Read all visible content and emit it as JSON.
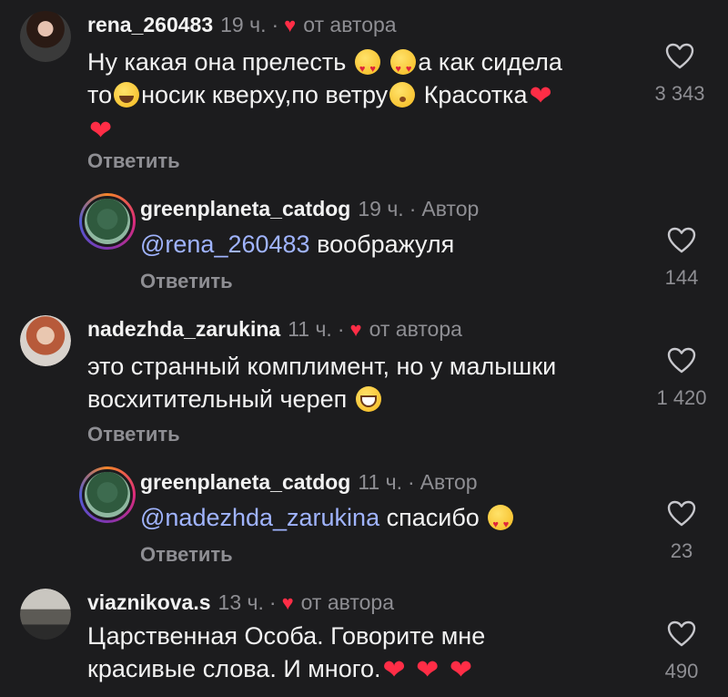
{
  "comments": [
    {
      "username": "rena_260483",
      "time": "19 ч.",
      "dot": "·",
      "from_author": "от автора",
      "text_parts": [
        "Ну какая она прелесть ",
        "а как сидела",
        "то",
        "носик кверху,по ветру",
        "Красотка"
      ],
      "reply_label": "Ответить",
      "likes": "3 343"
    },
    {
      "username": "greenplaneta_catdog",
      "time": "19 ч.",
      "dot": "·",
      "author_badge": "Автор",
      "mention": "@rena_260483",
      "text": " воображуля",
      "reply_label": "Ответить",
      "likes": "144"
    },
    {
      "username": "nadezhda_zarukina",
      "time": "11 ч.",
      "dot": "·",
      "from_author": "от автора",
      "text_line1": "это странный комплимент, но у малышки",
      "text_line2": "восхитительный череп",
      "reply_label": "Ответить",
      "likes": "1 420"
    },
    {
      "username": "greenplaneta_catdog",
      "time": "11 ч.",
      "dot": "·",
      "author_badge": "Автор",
      "mention": "@nadezhda_zarukina",
      "text": " спасибо",
      "reply_label": "Ответить",
      "likes": "23"
    },
    {
      "username": "viaznikova.s",
      "time": "13 ч.",
      "dot": "·",
      "from_author": "от автора",
      "text_line1": "Царственная Особа. Говорите мне",
      "text_line2": "красивые слова. И много.",
      "likes": "490"
    }
  ],
  "colors": {
    "background": "#1c1c1e",
    "text": "#f2f2f2",
    "muted": "#8e8e93",
    "heart": "#ff2d46",
    "mention": "#a0b4ff"
  }
}
